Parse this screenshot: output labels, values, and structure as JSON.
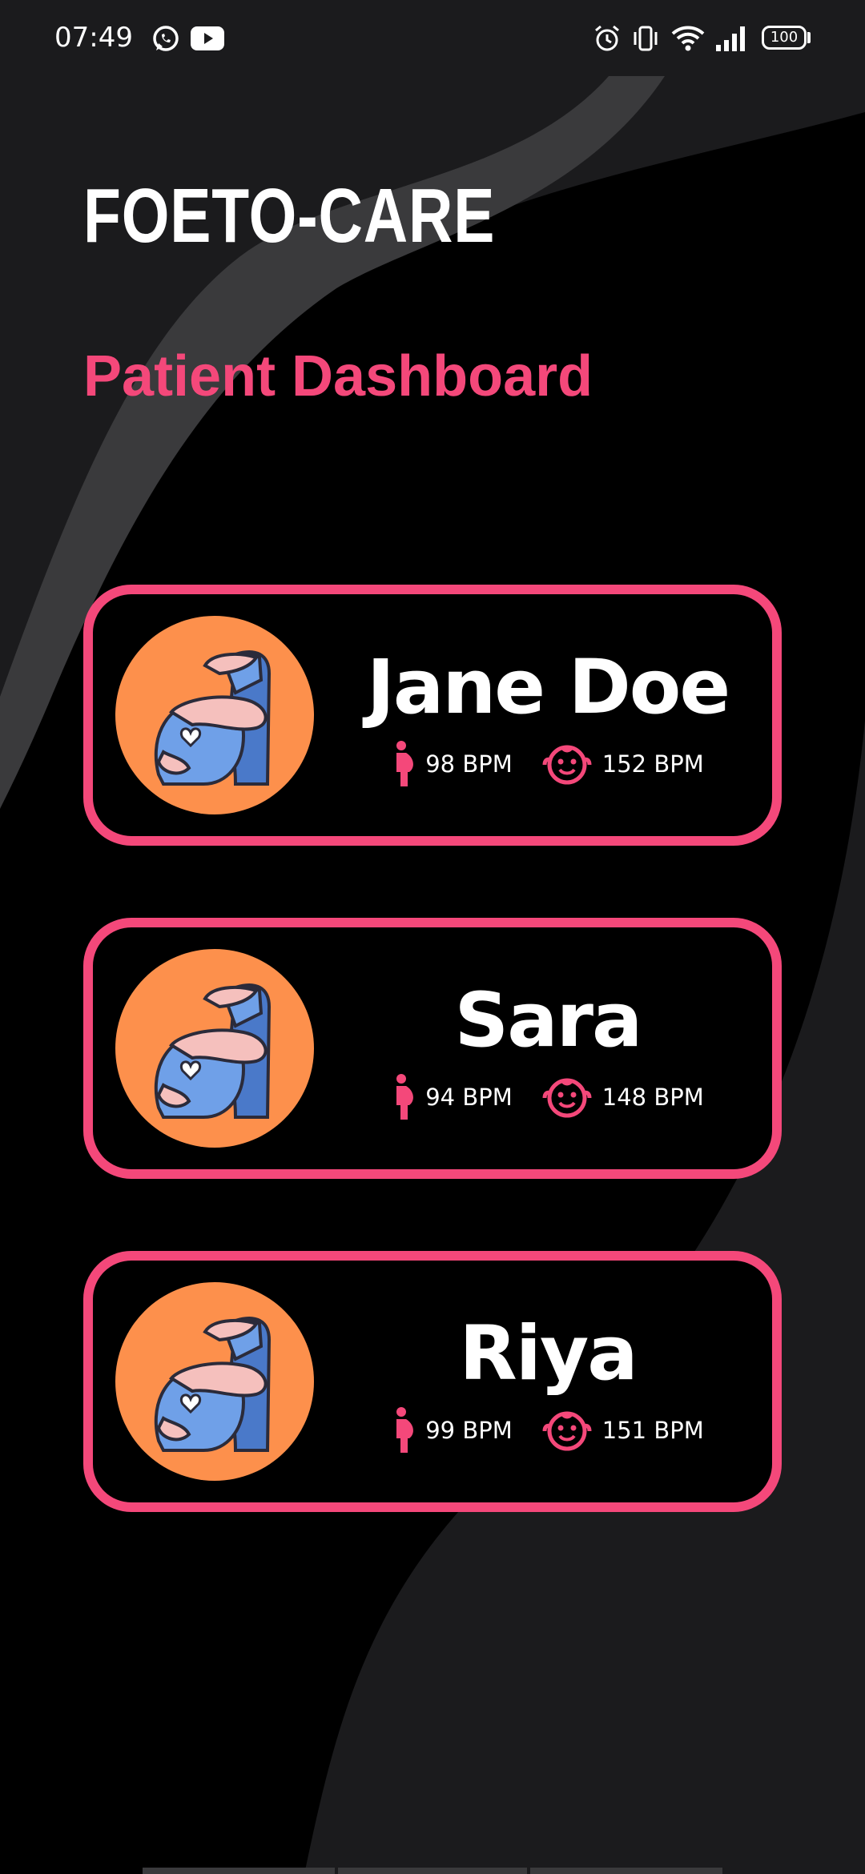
{
  "status_bar": {
    "time": "07:49",
    "notification_icons": [
      "whatsapp-icon",
      "youtube-icon"
    ],
    "system_icons": [
      "alarm-icon",
      "vibrate-icon",
      "wifi-icon",
      "signal-icon",
      "battery-icon"
    ],
    "battery_level": "100"
  },
  "app": {
    "title": "FOETO-CARE",
    "subtitle": "Patient Dashboard"
  },
  "colors": {
    "accent": "#f4487a",
    "avatar_bg": "#fd904c",
    "background": "#000000",
    "background_wave": "#1b1b1d",
    "background_wave_light": "#3a3a3c",
    "text": "#ffffff"
  },
  "patients": [
    {
      "name": "Jane Doe",
      "avatar_icon": "pregnant-woman-icon",
      "mother_bpm": "98 BPM",
      "baby_bpm": "152 BPM"
    },
    {
      "name": "Sara",
      "avatar_icon": "pregnant-woman-icon",
      "mother_bpm": "94 BPM",
      "baby_bpm": "148 BPM"
    },
    {
      "name": "Riya",
      "avatar_icon": "pregnant-woman-icon",
      "mother_bpm": "99 BPM",
      "baby_bpm": "151 BPM"
    }
  ]
}
